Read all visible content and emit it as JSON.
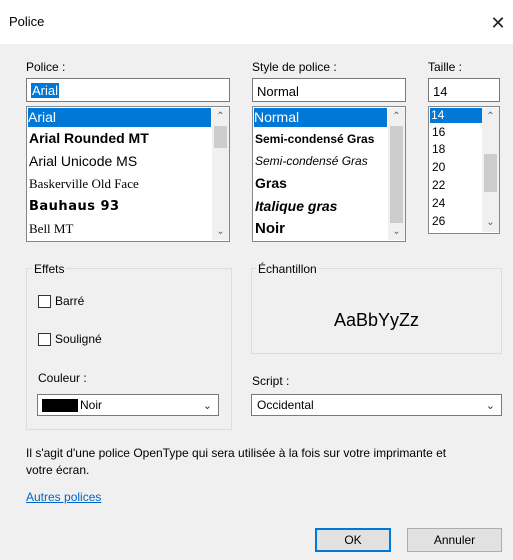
{
  "window": {
    "title": "Police",
    "close_glyph": "✕"
  },
  "font": {
    "label": "Police :",
    "value": "Arial",
    "items": [
      "Arial",
      "Arial Rounded MT",
      "Arial Unicode MS",
      "Baskerville Old Face",
      "Bauhaus 93",
      "Bell MT"
    ],
    "selected": "Arial"
  },
  "style": {
    "label": "Style de police :",
    "value": "Normal",
    "items": [
      "Normal",
      "Semi-condensé Gras",
      "Semi-condensé Gras",
      "Gras",
      "Italique gras",
      "Noir"
    ],
    "selected": "Normal"
  },
  "size": {
    "label": "Taille :",
    "value": "14",
    "items": [
      "14",
      "16",
      "18",
      "20",
      "22",
      "24",
      "26"
    ],
    "selected": "14"
  },
  "effects": {
    "label": "Effets",
    "strike_label": "Barré",
    "underline_label": "Souligné",
    "color_label": "Couleur :",
    "color_value": "Noir",
    "color_swatch": "#000000"
  },
  "sample": {
    "label": "Échantillon",
    "text": "AaBbYyZz"
  },
  "script": {
    "label": "Script :",
    "value": "Occidental"
  },
  "description": "Il s'agit d'une police OpenType qui sera utilisée à la fois sur votre imprimante et votre écran.",
  "more_fonts_link": "Autres polices",
  "buttons": {
    "ok": "OK",
    "cancel": "Annuler"
  },
  "colors": {
    "accent": "#0078d7",
    "link": "#0066cc"
  }
}
